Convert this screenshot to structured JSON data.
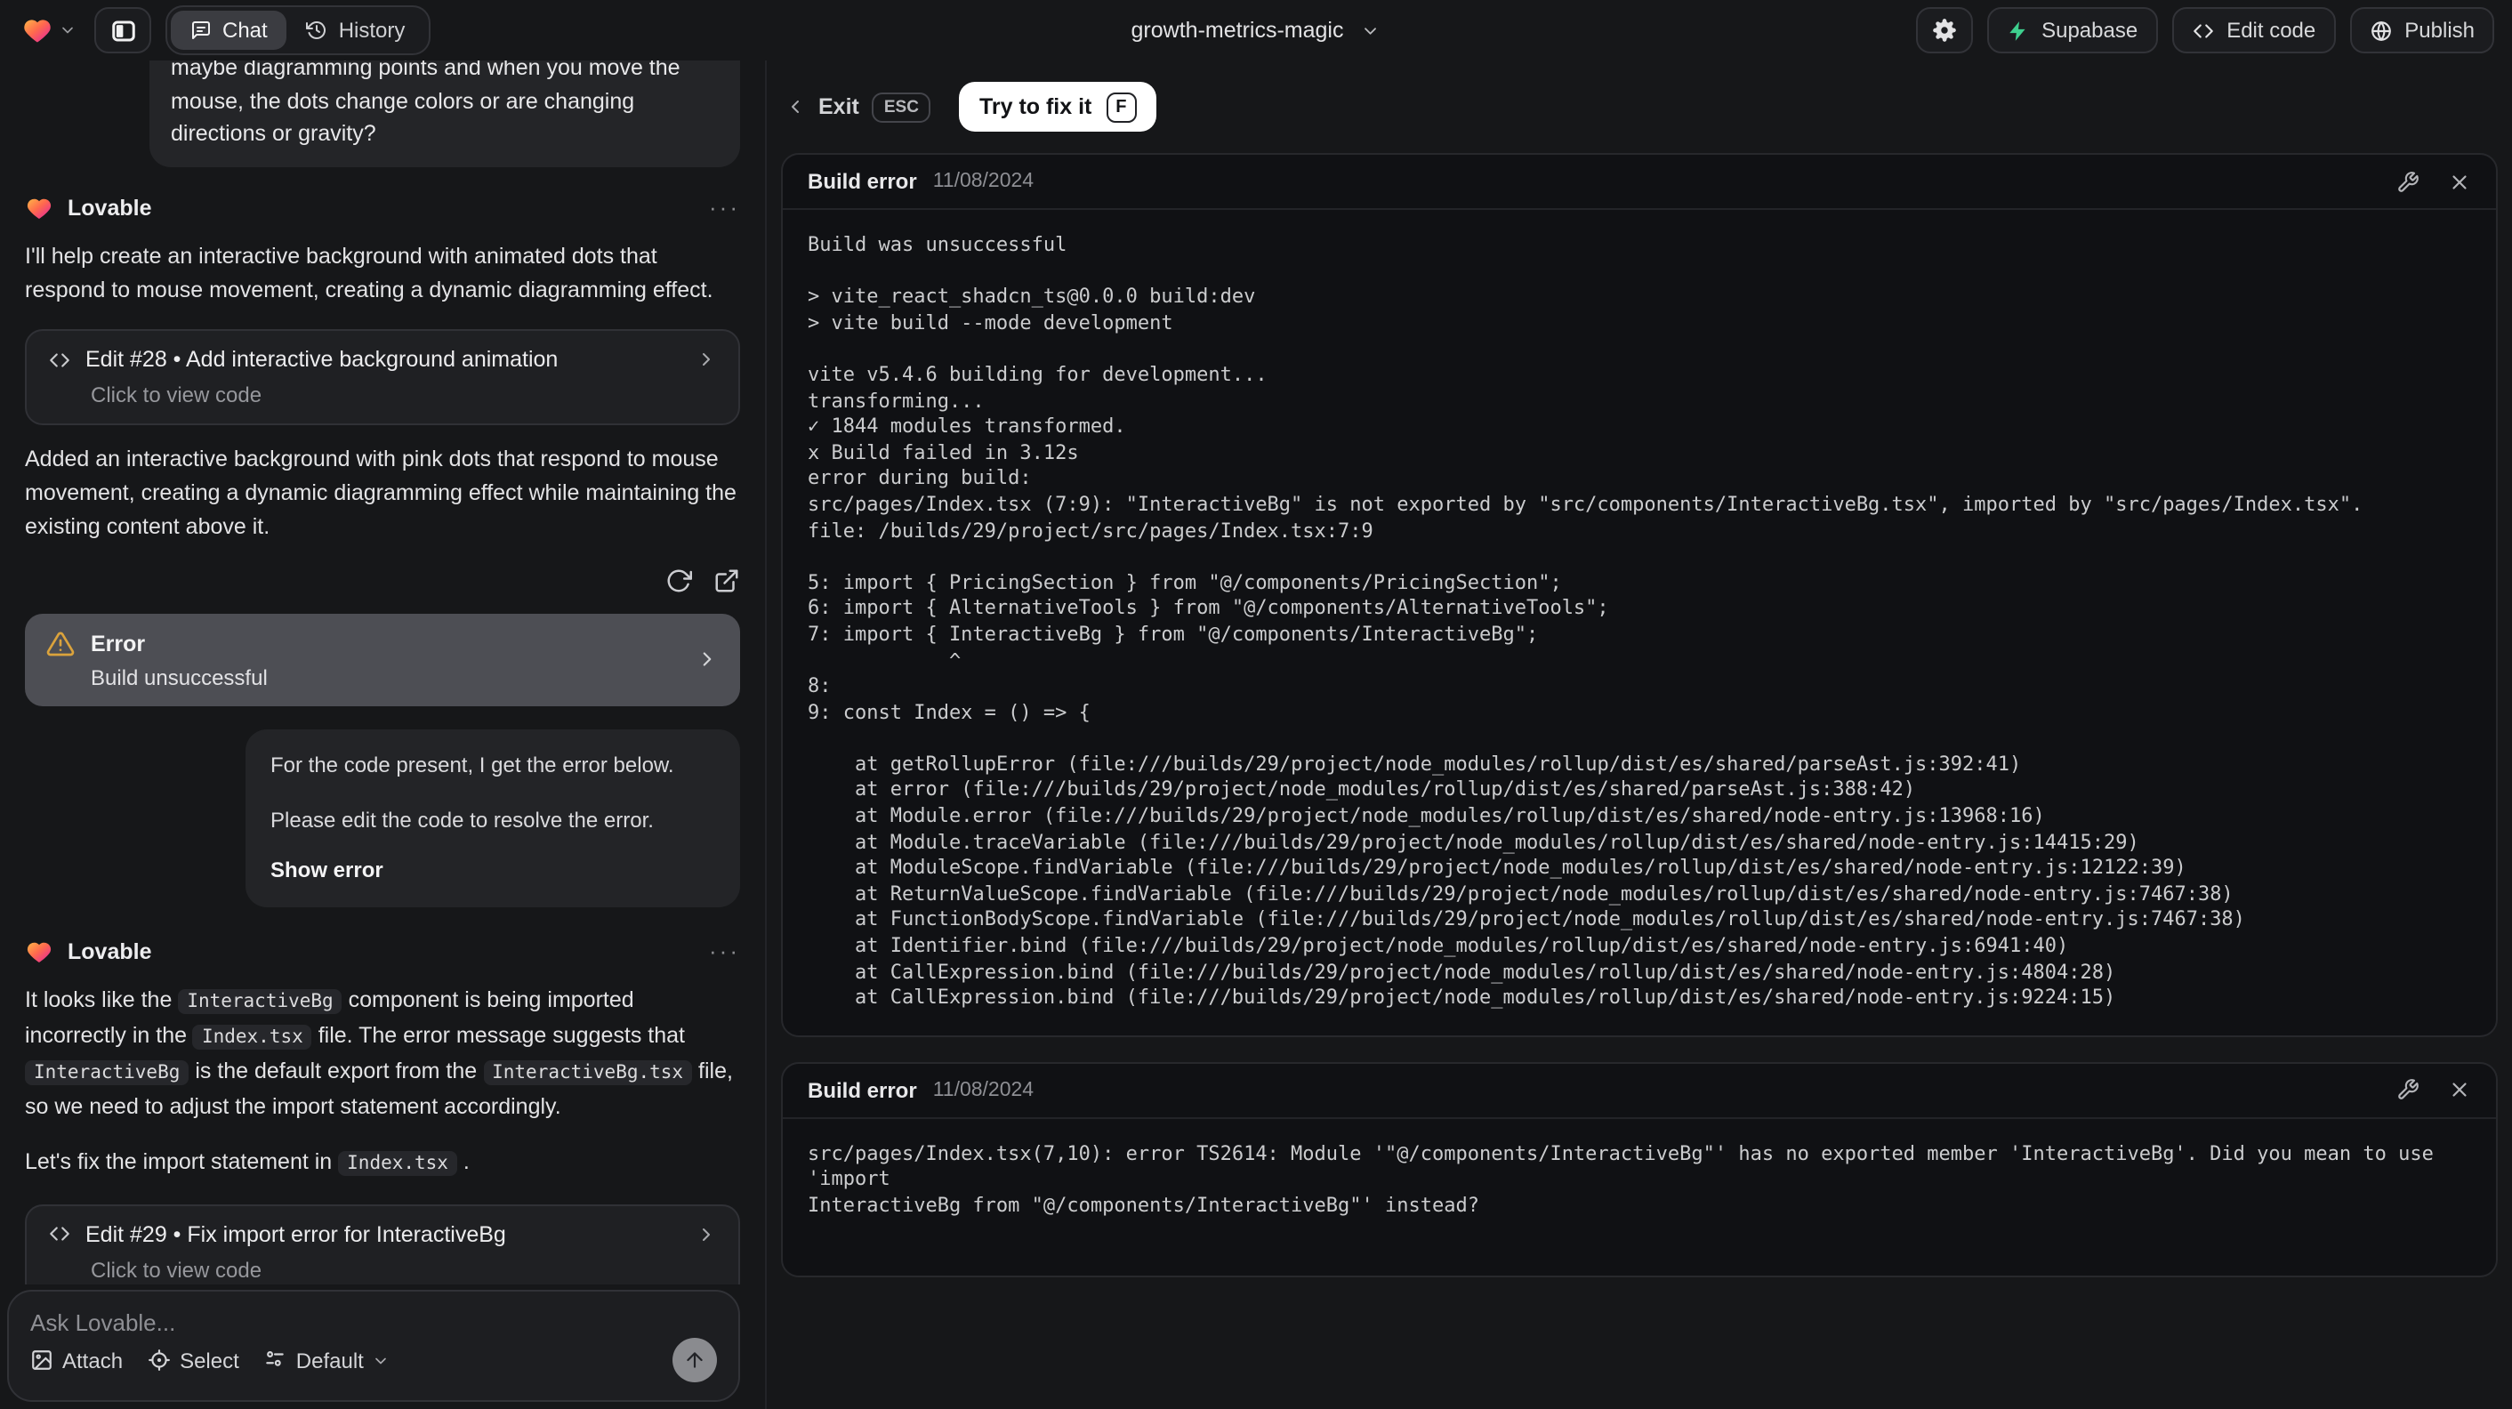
{
  "topbar": {
    "tabs": {
      "chat": "Chat",
      "history": "History"
    },
    "project_name": "growth-metrics-magic",
    "buttons": {
      "supabase": "Supabase",
      "edit_code": "Edit code",
      "publish": "Publish"
    }
  },
  "icons": {
    "ellipsis": "···"
  },
  "chat": {
    "assistant_name": "Lovable",
    "user_message": "maybe diagramming points and when you move the mouse, the dots change colors or are changing directions or gravity?",
    "p1": "I'll help create an interactive background with animated dots that respond to mouse movement, creating a dynamic diagramming effect.",
    "edit28_title": "Edit #28 • Add interactive background animation",
    "view_code": "Click to view code",
    "p2": "Added an interactive background with pink dots that respond to mouse movement, creating a dynamic diagramming effect while maintaining the existing content above it.",
    "error_card": {
      "title": "Error",
      "subtitle": "Build unsuccessful"
    },
    "prompt": {
      "line1": "For the code present, I get the error below.",
      "line2": "Please edit the code to resolve the error.",
      "action": "Show error"
    },
    "p3_segments": [
      {
        "text": "It looks like the "
      },
      {
        "text": "InteractiveBg",
        "code": true
      },
      {
        "text": " component is being imported incorrectly in the "
      },
      {
        "text": "Index.tsx",
        "code": true
      },
      {
        "text": " file. The error message suggests that "
      },
      {
        "text": "InteractiveBg",
        "code": true
      },
      {
        "text": " is the default export from the "
      },
      {
        "text": "InteractiveBg.tsx",
        "code": true
      },
      {
        "text": " file, so we need to adjust the import statement accordingly."
      }
    ],
    "p4_segments": [
      {
        "text": "Let's fix the import statement in "
      },
      {
        "text": "Index.tsx",
        "code": true
      },
      {
        "text": " ."
      }
    ],
    "edit29_title": "Edit #29 • Fix import error for InteractiveBg",
    "composer": {
      "placeholder": "Ask Lovable...",
      "attach": "Attach",
      "select": "Select",
      "mode": "Default"
    }
  },
  "preview": {
    "exit": "Exit",
    "exit_key": "ESC",
    "fix_label": "Try to fix it",
    "fix_key": "F",
    "panels": [
      {
        "title": "Build error",
        "date": "11/08/2024",
        "log": "Build was unsuccessful\n\n> vite_react_shadcn_ts@0.0.0 build:dev\n> vite build --mode development\n\nvite v5.4.6 building for development...\ntransforming...\n✓ 1844 modules transformed.\nx Build failed in 3.12s\nerror during build:\nsrc/pages/Index.tsx (7:9): \"InteractiveBg\" is not exported by \"src/components/InteractiveBg.tsx\", imported by \"src/pages/Index.tsx\".\nfile: /builds/29/project/src/pages/Index.tsx:7:9\n\n5: import { PricingSection } from \"@/components/PricingSection\";\n6: import { AlternativeTools } from \"@/components/AlternativeTools\";\n7: import { InteractiveBg } from \"@/components/InteractiveBg\";\n            ^\n8:\n9: const Index = () => {\n\n    at getRollupError (file:///builds/29/project/node_modules/rollup/dist/es/shared/parseAst.js:392:41)\n    at error (file:///builds/29/project/node_modules/rollup/dist/es/shared/parseAst.js:388:42)\n    at Module.error (file:///builds/29/project/node_modules/rollup/dist/es/shared/node-entry.js:13968:16)\n    at Module.traceVariable (file:///builds/29/project/node_modules/rollup/dist/es/shared/node-entry.js:14415:29)\n    at ModuleScope.findVariable (file:///builds/29/project/node_modules/rollup/dist/es/shared/node-entry.js:12122:39)\n    at ReturnValueScope.findVariable (file:///builds/29/project/node_modules/rollup/dist/es/shared/node-entry.js:7467:38)\n    at FunctionBodyScope.findVariable (file:///builds/29/project/node_modules/rollup/dist/es/shared/node-entry.js:7467:38)\n    at Identifier.bind (file:///builds/29/project/node_modules/rollup/dist/es/shared/node-entry.js:6941:40)\n    at CallExpression.bind (file:///builds/29/project/node_modules/rollup/dist/es/shared/node-entry.js:4804:28)\n    at CallExpression.bind (file:///builds/29/project/node_modules/rollup/dist/es/shared/node-entry.js:9224:15)"
      },
      {
        "title": "Build error",
        "date": "11/08/2024",
        "log": "src/pages/Index.tsx(7,10): error TS2614: Module '\"@/components/InteractiveBg\"' has no exported member 'InteractiveBg'. Did you mean to use 'import\nInteractiveBg from \"@/components/InteractiveBg\"' instead?"
      }
    ]
  }
}
